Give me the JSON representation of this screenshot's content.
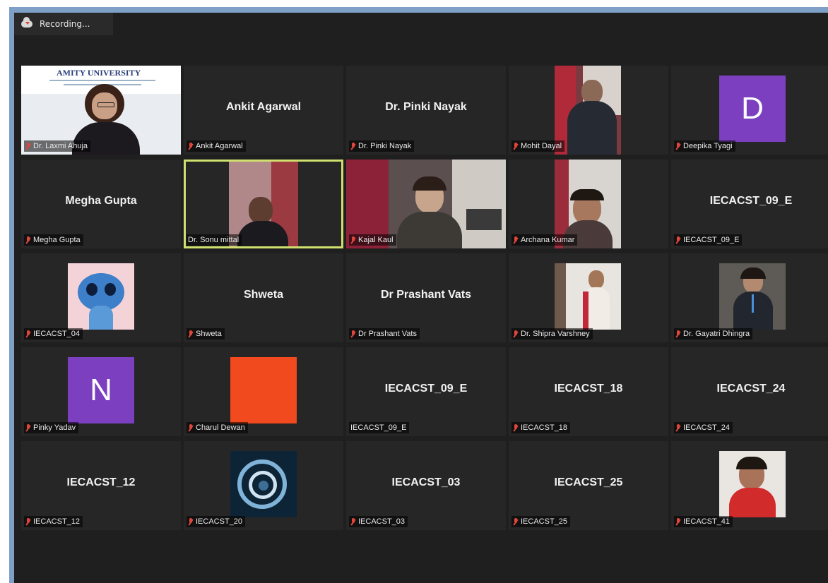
{
  "recording": {
    "label": "Recording..."
  },
  "colors": {
    "frame": "#7e9fc6",
    "background": "#1f1f1f",
    "tile": "#262626",
    "active_outline": "#cfe06e",
    "mic_muted": "#e0463a",
    "avatar_purple": "#7b3fbf",
    "avatar_orange": "#f04a1e"
  },
  "participants": [
    {
      "name": "Dr. Laxmi Ahuja",
      "display": "",
      "type": "video"
    },
    {
      "name": "Ankit Agarwal",
      "display": "Ankit Agarwal",
      "type": "name"
    },
    {
      "name": "Dr. Pinki Nayak",
      "display": "Dr. Pinki Nayak",
      "type": "name"
    },
    {
      "name": "Mohit Dayal",
      "display": "",
      "type": "video"
    },
    {
      "name": "Deepika Tyagi",
      "display": "",
      "type": "avatar",
      "letter": "D"
    },
    {
      "name": "Megha Gupta",
      "display": "Megha Gupta",
      "type": "name"
    },
    {
      "name": "Dr. Sonu mittal",
      "display": "",
      "type": "video",
      "active": true
    },
    {
      "name": "Kajal Kaul",
      "display": "",
      "type": "video"
    },
    {
      "name": "Archana Kumar",
      "display": "",
      "type": "video"
    },
    {
      "name": "IECACST_09_E",
      "display": "IECACST_09_E",
      "type": "name"
    },
    {
      "name": "IECACST_04",
      "display": "",
      "type": "picture"
    },
    {
      "name": "Shweta",
      "display": "Shweta",
      "type": "name"
    },
    {
      "name": "Dr Prashant Vats",
      "display": "Dr Prashant Vats",
      "type": "name"
    },
    {
      "name": "Dr. Shipra Varshney",
      "display": "",
      "type": "video"
    },
    {
      "name": "Dr. Gayatri Dhingra",
      "display": "",
      "type": "video"
    },
    {
      "name": "Pinky Yadav",
      "display": "",
      "type": "avatar",
      "letter": "N"
    },
    {
      "name": "Charul Dewan",
      "display": "",
      "type": "picture"
    },
    {
      "name": "IECACST_09_E",
      "display": "IECACST_09_E",
      "type": "name"
    },
    {
      "name": "IECACST_18",
      "display": "IECACST_18",
      "type": "name"
    },
    {
      "name": "IECACST_24",
      "display": "IECACST_24",
      "type": "name"
    },
    {
      "name": "IECACST_12",
      "display": "IECACST_12",
      "type": "name"
    },
    {
      "name": "IECACST_20",
      "display": "",
      "type": "picture"
    },
    {
      "name": "IECACST_03",
      "display": "IECACST_03",
      "type": "name"
    },
    {
      "name": "IECACST_25",
      "display": "IECACST_25",
      "type": "name"
    },
    {
      "name": "IECACST_41",
      "display": "",
      "type": "video"
    }
  ],
  "logo_text": "AMITY UNIVERSITY"
}
